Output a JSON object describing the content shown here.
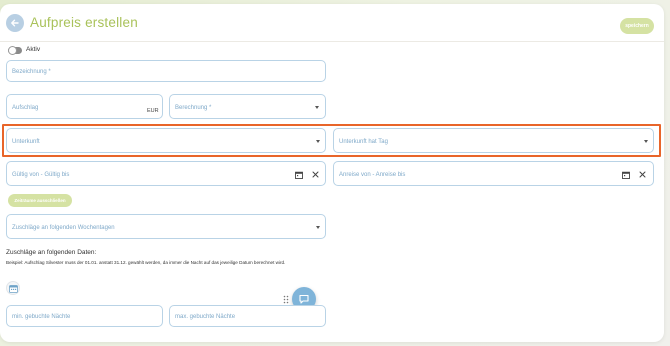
{
  "header": {
    "title": "Aufpreis erstellen",
    "save_label": "speichern"
  },
  "active_toggle": {
    "label": "Aktiv",
    "checked": false
  },
  "fields": {
    "bezeichnung": {
      "placeholder": "Bezeichnung *"
    },
    "aufschlag": {
      "placeholder": "Aufschlag",
      "suffix": "EUR"
    },
    "berechnung": {
      "placeholder": "Berechnung *"
    },
    "unterkunft": {
      "placeholder": "Unterkunft"
    },
    "unterkunft_tag": {
      "placeholder": "Unterkunft hat Tag"
    },
    "gueltig": {
      "placeholder": "Gültig von - Gültig bis"
    },
    "anreise": {
      "placeholder": "Anreise von - Anreise bis"
    },
    "wochentage": {
      "placeholder": "Zuschläge an folgenden Wochentagen"
    },
    "min_naechte": {
      "placeholder": "min. gebuchte Nächte"
    },
    "max_naechte": {
      "placeholder": "max. gebuchte Nächte"
    }
  },
  "exclude_button": {
    "label": "Zeiträume ausschließen"
  },
  "dates_section": {
    "title": "Zuschläge an folgenden Daten:",
    "text": "Beispiel: Aufschlag Silvester muss der 01.01. anstatt 31.12. gewählt werden, da immer die Nacht auf das jeweilige Datum berechnet wird."
  },
  "colors": {
    "accent_green": "#a9c25a",
    "field_border": "#b9d3e6",
    "placeholder": "#7fa9c9",
    "highlight": "#e8652a",
    "chat": "#7fb4d9"
  },
  "icons": [
    "back-arrow-icon",
    "caret-down-icon",
    "calendar-icon",
    "close-icon",
    "drag-handle-icon",
    "chat-icon"
  ]
}
